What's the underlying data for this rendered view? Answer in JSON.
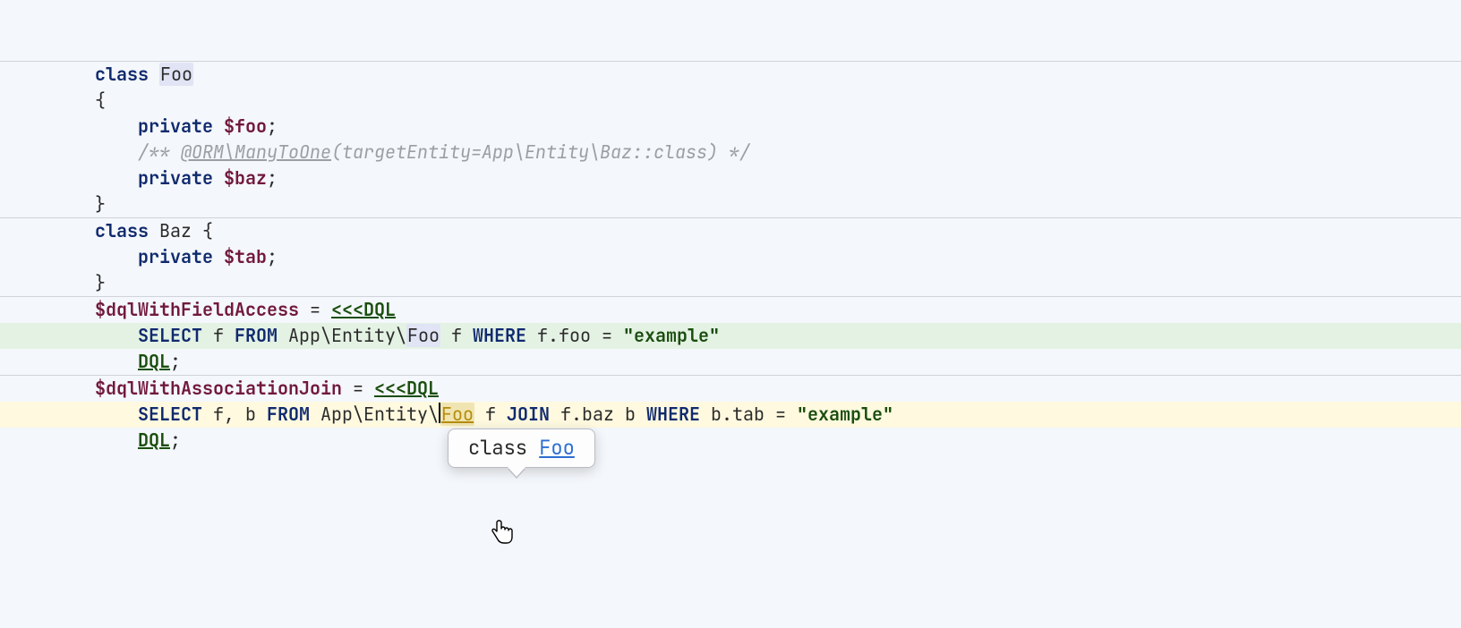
{
  "colors": {
    "bg": "#f4f7fb",
    "keyword": "#102a6e",
    "variable": "#71193c",
    "comment": "#9a9fa3",
    "string": "#1a4e0e",
    "hl_green": "#e4f2e4",
    "hl_yellow": "#fef9df",
    "link": "#2d6fd2"
  },
  "tooltip": {
    "prefix": "class ",
    "class_name": "Foo"
  },
  "code": {
    "block1": {
      "l1": {
        "class_kw": "class",
        "class_name": "Foo"
      },
      "l2": "{",
      "l3": {
        "private_kw": "private",
        "var": "$foo",
        "semi": ";"
      },
      "l4": "",
      "l5": {
        "open": "/** ",
        "annotation": "@ORM\\ManyToOne",
        "args": "(targetEntity=App\\Entity\\Baz::class) */"
      },
      "l6": {
        "private_kw": "private",
        "var": "$baz",
        "semi": ";"
      },
      "l7": "}"
    },
    "block2": {
      "l1": {
        "class_kw": "class",
        "class_name": "Baz",
        "brace": " {"
      },
      "l2": {
        "private_kw": "private",
        "var": "$tab",
        "semi": ";"
      },
      "l3": "}"
    },
    "block3": {
      "l1": {
        "var": "$dqlWithFieldAccess",
        "eq": " = ",
        "heredoc": "<<<DQL"
      },
      "l2": {
        "sql_select": "SELECT",
        "f": " f ",
        "sql_from": "FROM",
        "path": " App\\Entity\\",
        "foo": "Foo",
        "alias": " f ",
        "sql_where": "WHERE",
        "expr": " f.foo = ",
        "str": "\"example\""
      },
      "l3": {
        "heredoc_end": "DQL",
        "semi": ";"
      }
    },
    "block4": {
      "l1": {
        "var": "$dqlWithAssociationJoin",
        "eq": " = ",
        "heredoc": "<<<DQL"
      },
      "l2": {
        "sql_select": "SELECT",
        "fb": " f, b ",
        "sql_from": "FROM",
        "path": " App\\Entity\\",
        "foo": "Foo",
        "alias": " f ",
        "sql_join": "JOIN",
        "joinexpr": " f.baz b ",
        "sql_where": "WHERE",
        "expr": " b.tab = ",
        "str": "\"example\""
      },
      "l3": {
        "heredoc_end": "DQL",
        "semi": ";"
      }
    }
  }
}
